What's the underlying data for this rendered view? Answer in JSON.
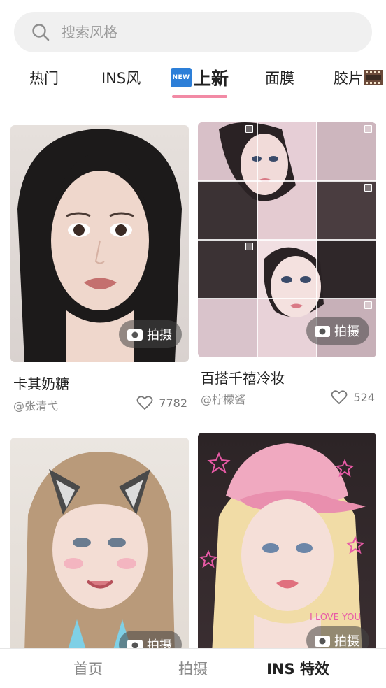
{
  "search": {
    "placeholder": "搜索风格"
  },
  "tabs": [
    {
      "label": "热门"
    },
    {
      "label": "INS风"
    },
    {
      "label": "上新",
      "badge": "NEW",
      "active": true
    },
    {
      "label": "面膜"
    },
    {
      "label": "胶片"
    }
  ],
  "cards": [
    {
      "title": "卡其奶糖",
      "author": "@张清弋",
      "likes": "7782",
      "shoot_label": "拍摄"
    },
    {
      "title": "百搭千禧冷妆",
      "author": "@柠檬酱",
      "likes": "524",
      "shoot_label": "拍摄"
    },
    {
      "shoot_label": "拍摄"
    },
    {
      "shoot_label": "拍摄"
    }
  ],
  "bottom_nav": [
    {
      "label": "首页"
    },
    {
      "label": "拍摄"
    },
    {
      "label": "INS 特效",
      "active": true
    }
  ],
  "colors": {
    "accent_underline": "#f28aa5",
    "new_badge": "#2d7fd8",
    "search_bg": "#f0f0f0"
  }
}
